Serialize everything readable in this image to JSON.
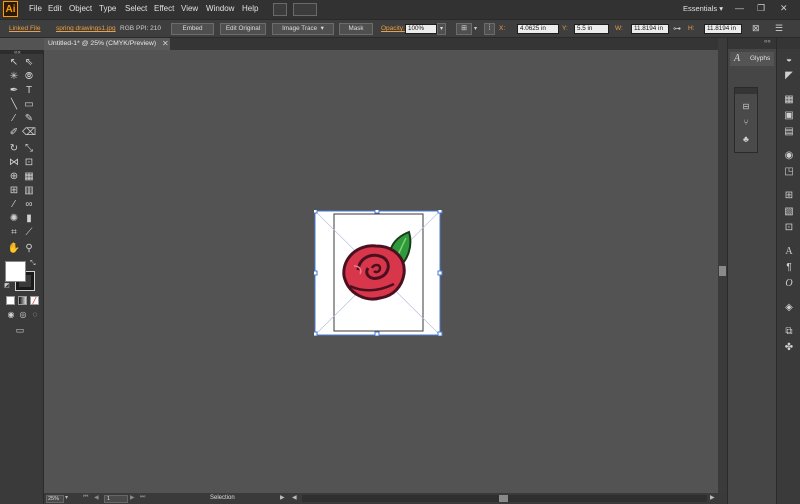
{
  "app": {
    "logo": "Ai"
  },
  "menu": [
    "File",
    "Edit",
    "Object",
    "Type",
    "Select",
    "Effect",
    "View",
    "Window",
    "Help"
  ],
  "workspace": {
    "label": "Essentials",
    "arrow": "▾"
  },
  "window_controls": {
    "minimize": "—",
    "restore": "❐",
    "close": "✕"
  },
  "control_bar": {
    "linked_file": "Linked File",
    "filename": "spring drawings1.jpg",
    "color_mode": "RGB",
    "ppi": "PPI: 210",
    "embed": "Embed",
    "edit_original": "Edit Original",
    "image_trace": "Image Trace",
    "mask": "Mask",
    "opacity_label": "Opacity:",
    "opacity_value": "100%",
    "x_label": "X:",
    "x_value": "4.0625 in",
    "y_label": "Y:",
    "y_value": "5.5 in",
    "w_label": "W:",
    "w_value": "11.8194 in",
    "h_label": "H:",
    "h_value": "11.8194 in"
  },
  "document_tab": {
    "title": "Untitled-1* @ 25% (CMYK/Preview)",
    "close": "✕"
  },
  "status_bar": {
    "zoom": "25%",
    "page": "1",
    "tool": "Selection"
  },
  "panels": {
    "glyphs_label": "Glyphs",
    "glyphs_icon": "A"
  },
  "colors": {
    "accent": "#e8a04a",
    "selection": "#4a78d4",
    "rose": "#d8364a",
    "leaf": "#2e9a3a"
  }
}
